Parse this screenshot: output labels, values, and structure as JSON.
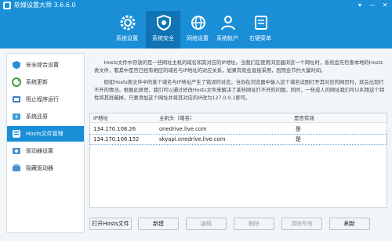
{
  "app": {
    "title": "软媒设置大师 3.6.6.0"
  },
  "window_controls": [
    "▾",
    "—",
    "✕"
  ],
  "toolbar": [
    {
      "label": "系统设置",
      "icon": "gear-icon"
    },
    {
      "label": "系统安全",
      "icon": "shield-icon"
    },
    {
      "label": "网络设置",
      "icon": "globe-icon"
    },
    {
      "label": "系统帐户",
      "icon": "user-icon"
    },
    {
      "label": "右键菜单",
      "icon": "context-menu-icon"
    }
  ],
  "sidebar": [
    {
      "label": "安全综合设置",
      "icon": "shield-icon",
      "color": "#2a8fd6"
    },
    {
      "label": "系统更新",
      "icon": "refresh-icon",
      "color": "#3a9a3a"
    },
    {
      "label": "阻止程序运行",
      "icon": "block-icon",
      "color": "#3d7fcc"
    },
    {
      "label": "系统还原",
      "icon": "restore-icon",
      "color": "#3d9bd6"
    },
    {
      "label": "Hosts文件管理",
      "icon": "hosts-file-icon",
      "color": "#ffffff"
    },
    {
      "label": "驱动器设置",
      "icon": "drive-icon",
      "color": "#4a8fd0"
    },
    {
      "label": "隐藏驱动器",
      "icon": "hidden-drive-icon",
      "color": "#4a8fd0"
    }
  ],
  "description": {
    "para1": "Hosts文件中存放的是一些网址主机的域名和其对应的IP地址。当我们在使用浏览器浏览一个网址时，系统会先检查本地的Hosts表文件，看其中是否已经有相应的域名与IP地址的对应关系，如果有就会直接采用，因而会节约大量时间。",
    "para2": "假如Hosts表文件中的某个域名与IP地址产生了错误的对应，当你在浏览器中输入这个域名试图打开其对应的网页时，就会出现打不开的情况。根据此原理，我们可以通过修改Hosts文件来解决了某些网址打不开的问题。同时，一些成人的网址我们可以利用这个特性将其屏蔽掉，只要添加这个网址并将其对应的IP改为127.0.0.1即可。"
  },
  "table": {
    "headers": [
      "IP地址",
      "主机头（域名）",
      "是否有效"
    ],
    "rows": [
      {
        "ip": "134.170.108.26",
        "host": "onedrive.live.com",
        "valid": "是",
        "selected": false
      },
      {
        "ip": "134.170.108.152",
        "host": "skyapi.onedrive.live.com",
        "valid": "是",
        "selected": true
      }
    ]
  },
  "buttons": [
    {
      "label": "打开Hosts文件",
      "name": "open-hosts-button",
      "disabled": false
    },
    {
      "label": "新建",
      "name": "new-button",
      "disabled": false
    },
    {
      "label": "编辑",
      "name": "edit-button",
      "disabled": true
    },
    {
      "label": "删除",
      "name": "delete-button",
      "disabled": true
    },
    {
      "label": "清除所有",
      "name": "clear-all-button",
      "disabled": true
    },
    {
      "label": "刷新",
      "name": "refresh-button",
      "disabled": false
    }
  ],
  "colors": {
    "accent": "#1a8fd8",
    "accent_dark": "#0f73b6"
  }
}
